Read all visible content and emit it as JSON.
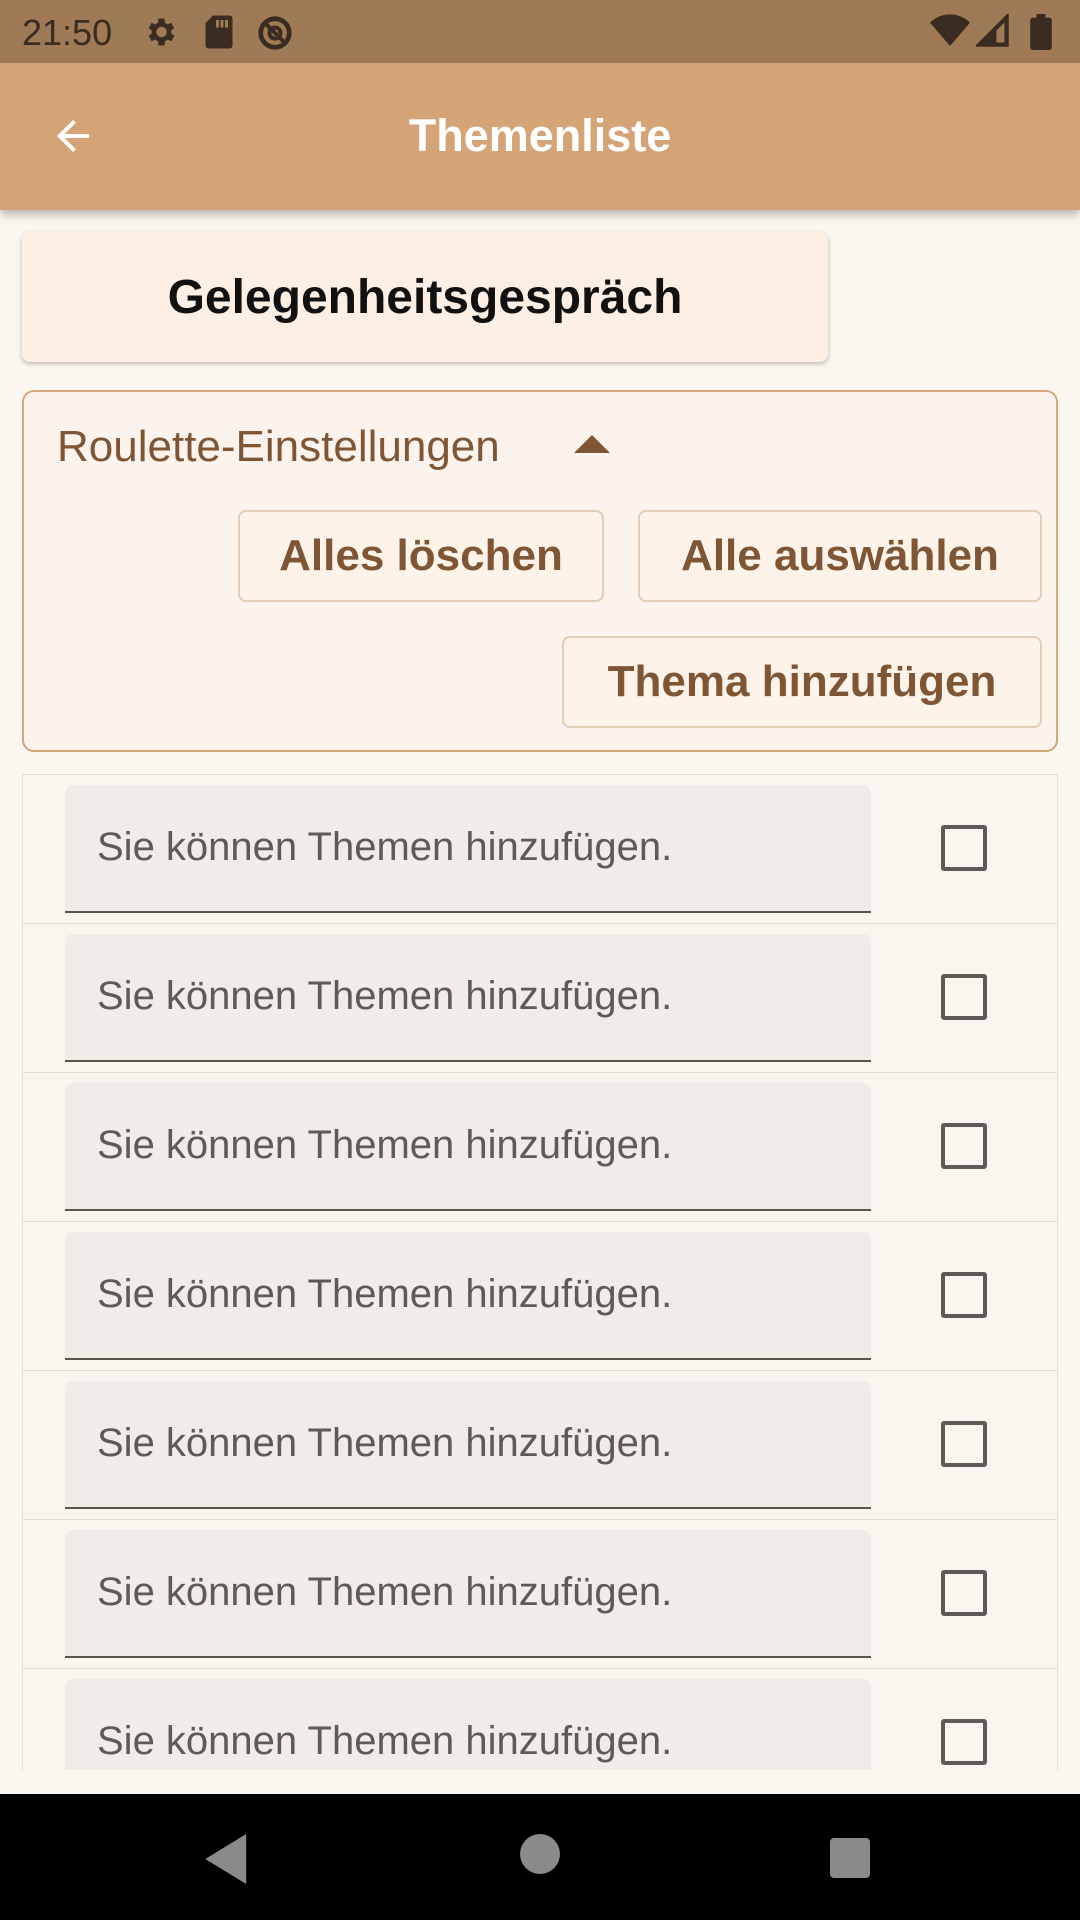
{
  "status_bar": {
    "time": "21:50",
    "left_icons": [
      "settings-icon",
      "sd-card-icon",
      "data-saver-icon"
    ],
    "right_icons": [
      "wifi-icon",
      "signal-icon",
      "battery-icon"
    ]
  },
  "app_bar": {
    "back_icon": "arrow-left-icon",
    "title": "Themenliste"
  },
  "mode_button": {
    "label": "Gelegenheitsgespräch"
  },
  "settings": {
    "title": "Roulette-Einstellungen",
    "toggle_icon": "caret-up-icon",
    "clear_label": "Alles löschen",
    "select_all_label": "Alle auswählen",
    "add_topic_label": "Thema hinzufügen"
  },
  "topics": [
    {
      "placeholder": "Sie können Themen hinzufügen.",
      "checked": false
    },
    {
      "placeholder": "Sie können Themen hinzufügen.",
      "checked": false
    },
    {
      "placeholder": "Sie können Themen hinzufügen.",
      "checked": false
    },
    {
      "placeholder": "Sie können Themen hinzufügen.",
      "checked": false
    },
    {
      "placeholder": "Sie können Themen hinzufügen.",
      "checked": false
    },
    {
      "placeholder": "Sie können Themen hinzufügen.",
      "checked": false
    },
    {
      "placeholder": "Sie können Themen hinzufügen.",
      "checked": false
    }
  ],
  "nav_bar": {
    "icons": [
      "nav-back-icon",
      "nav-home-icon",
      "nav-recents-icon"
    ]
  },
  "colors": {
    "status_bar": "#9f7a57",
    "app_bar": "#d5a476",
    "accent_text": "#7e5535",
    "background": "#fcf6f0"
  }
}
